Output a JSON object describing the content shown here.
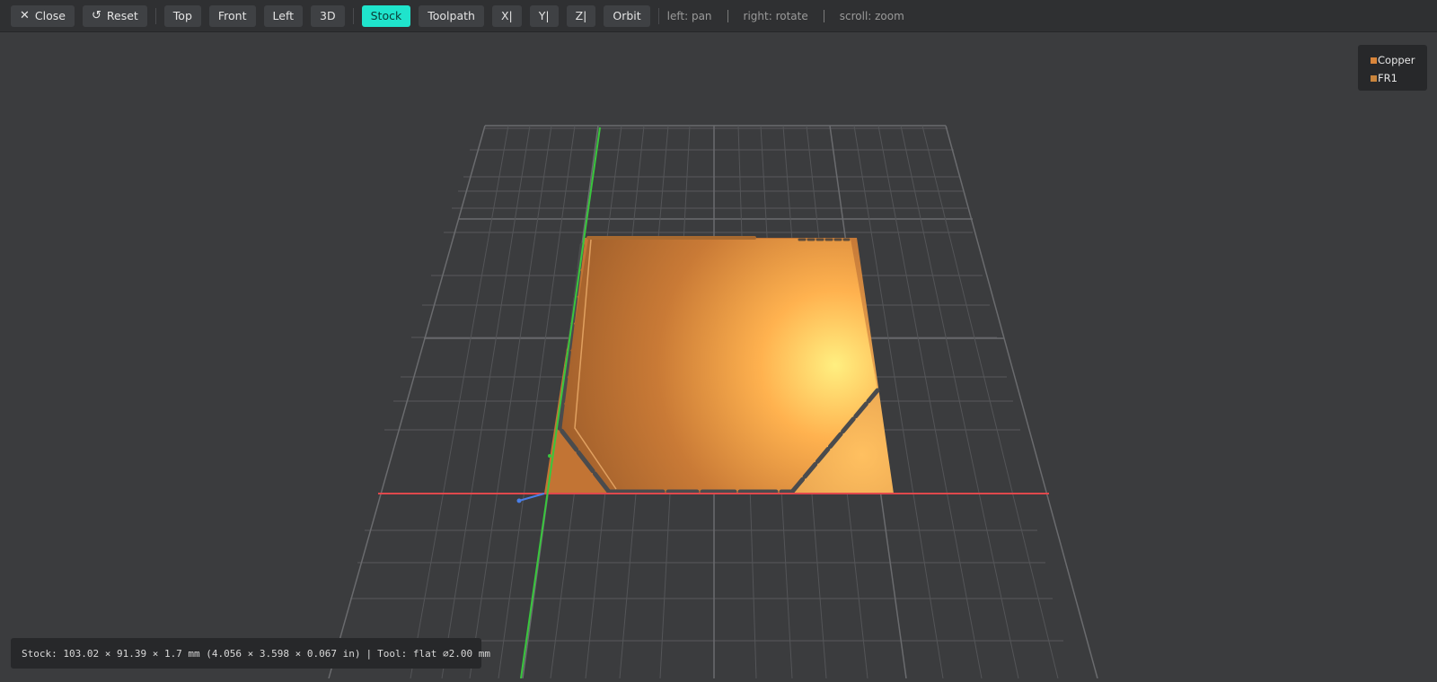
{
  "toolbar": {
    "close_label": "Close",
    "reset_label": "Reset",
    "view_top": "Top",
    "view_front": "Front",
    "view_left": "Left",
    "view_3d": "3D",
    "stock_label": "Stock",
    "toolpath_label": "Toolpath",
    "axis_x": "X|",
    "axis_y": "Y|",
    "axis_z": "Z|",
    "orbit_label": "Orbit",
    "active_button": "Stock",
    "hints": [
      "left: pan",
      "right: rotate",
      "scroll: zoom"
    ]
  },
  "legend": {
    "items": [
      {
        "label": "Copper",
        "color": "#d9853a"
      },
      {
        "label": "FR1",
        "color": "#c8843c"
      }
    ]
  },
  "status": {
    "stock_text": "Stock: 103.02 × 91.39 × 1.7 mm (4.056 × 3.598 × 0.067 in)",
    "tool_text": "Tool: flat ⌀2.00 mm"
  },
  "colors": {
    "accent": "#1fe4cc",
    "x_axis": "#e0484c",
    "y_axis": "#39c73d",
    "z_axis": "#4a7fe8",
    "grid": "#6a6b6e",
    "copper_light": "#ffe07a",
    "copper_dark": "#a2612c"
  },
  "icons": {
    "close": "close-icon",
    "reset": "reset-icon"
  }
}
